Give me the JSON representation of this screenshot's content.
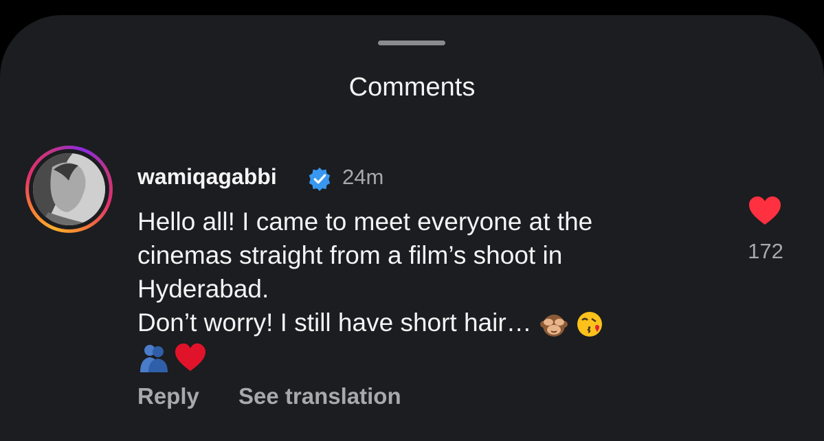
{
  "sheet": {
    "title": "Comments"
  },
  "comment": {
    "username": "wamiqagabbi",
    "verified_icon": "verified-badge-icon",
    "time": "24m",
    "lines": [
      "Hello all! I came to meet everyone at the",
      "cinemas straight from a film’s shoot in",
      "Hyderabad.",
      "Don’t worry! I still have short hair… "
    ],
    "emojis": [
      "see-no-evil-monkey-emoji",
      "face-blowing-kiss-emoji",
      "people-hugging-emoji",
      "red-heart-emoji"
    ],
    "like_icon": "heart-icon",
    "like_count": "172",
    "reply_label": "Reply",
    "translate_label": "See translation"
  },
  "colors": {
    "background": "#1c1d20",
    "text": "#f4f4f5",
    "muted": "#a8a9ad",
    "heart": "#ff3040",
    "verified": "#3897f0"
  }
}
